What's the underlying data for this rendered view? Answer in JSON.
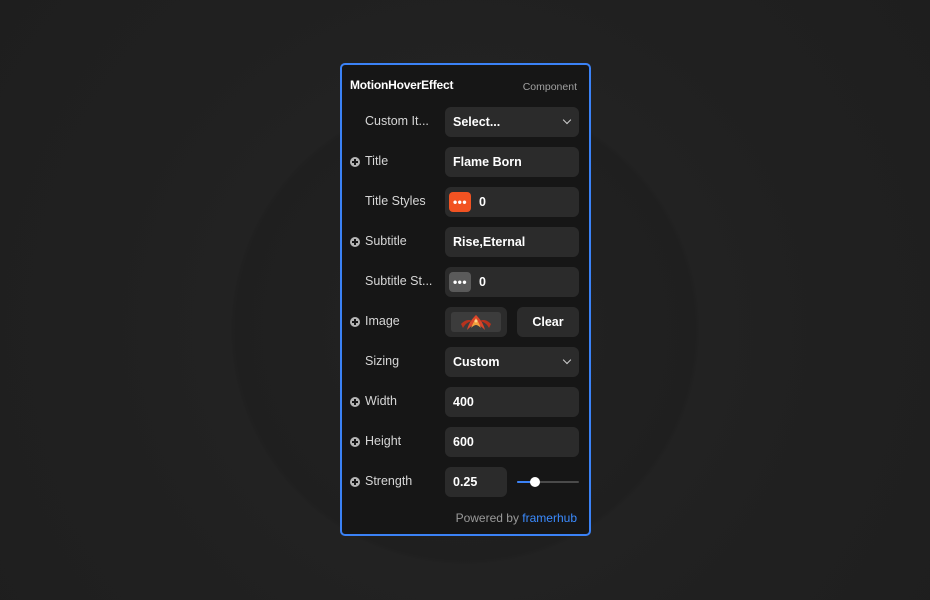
{
  "panel": {
    "title": "MotionHoverEffect",
    "tag": "Component"
  },
  "rows": {
    "custom_items": {
      "label": "Custom It...",
      "value": "Select..."
    },
    "title": {
      "label": "Title",
      "value": "Flame Born"
    },
    "title_styles": {
      "label": "Title Styles",
      "value": "0",
      "swatch_color": "#f25322",
      "icon": "ellipsis-icon"
    },
    "subtitle": {
      "label": "Subtitle",
      "value": "Rise,Eternal"
    },
    "subtitle_styles": {
      "label": "Subtitle St...",
      "value": "0",
      "swatch_color": "#5a5a5a",
      "icon": "ellipsis-icon"
    },
    "image": {
      "label": "Image",
      "clear_label": "Clear"
    },
    "sizing": {
      "label": "Sizing",
      "value": "Custom"
    },
    "width": {
      "label": "Width",
      "value": "400"
    },
    "height": {
      "label": "Height",
      "value": "600"
    },
    "strength": {
      "label": "Strength",
      "value": "0.25",
      "slider_fraction": 0.28
    }
  },
  "footer": {
    "prefix": "Powered by",
    "brand": "framerhub"
  },
  "colors": {
    "accent": "#3b82f6",
    "brand_link": "#3b8bff"
  }
}
